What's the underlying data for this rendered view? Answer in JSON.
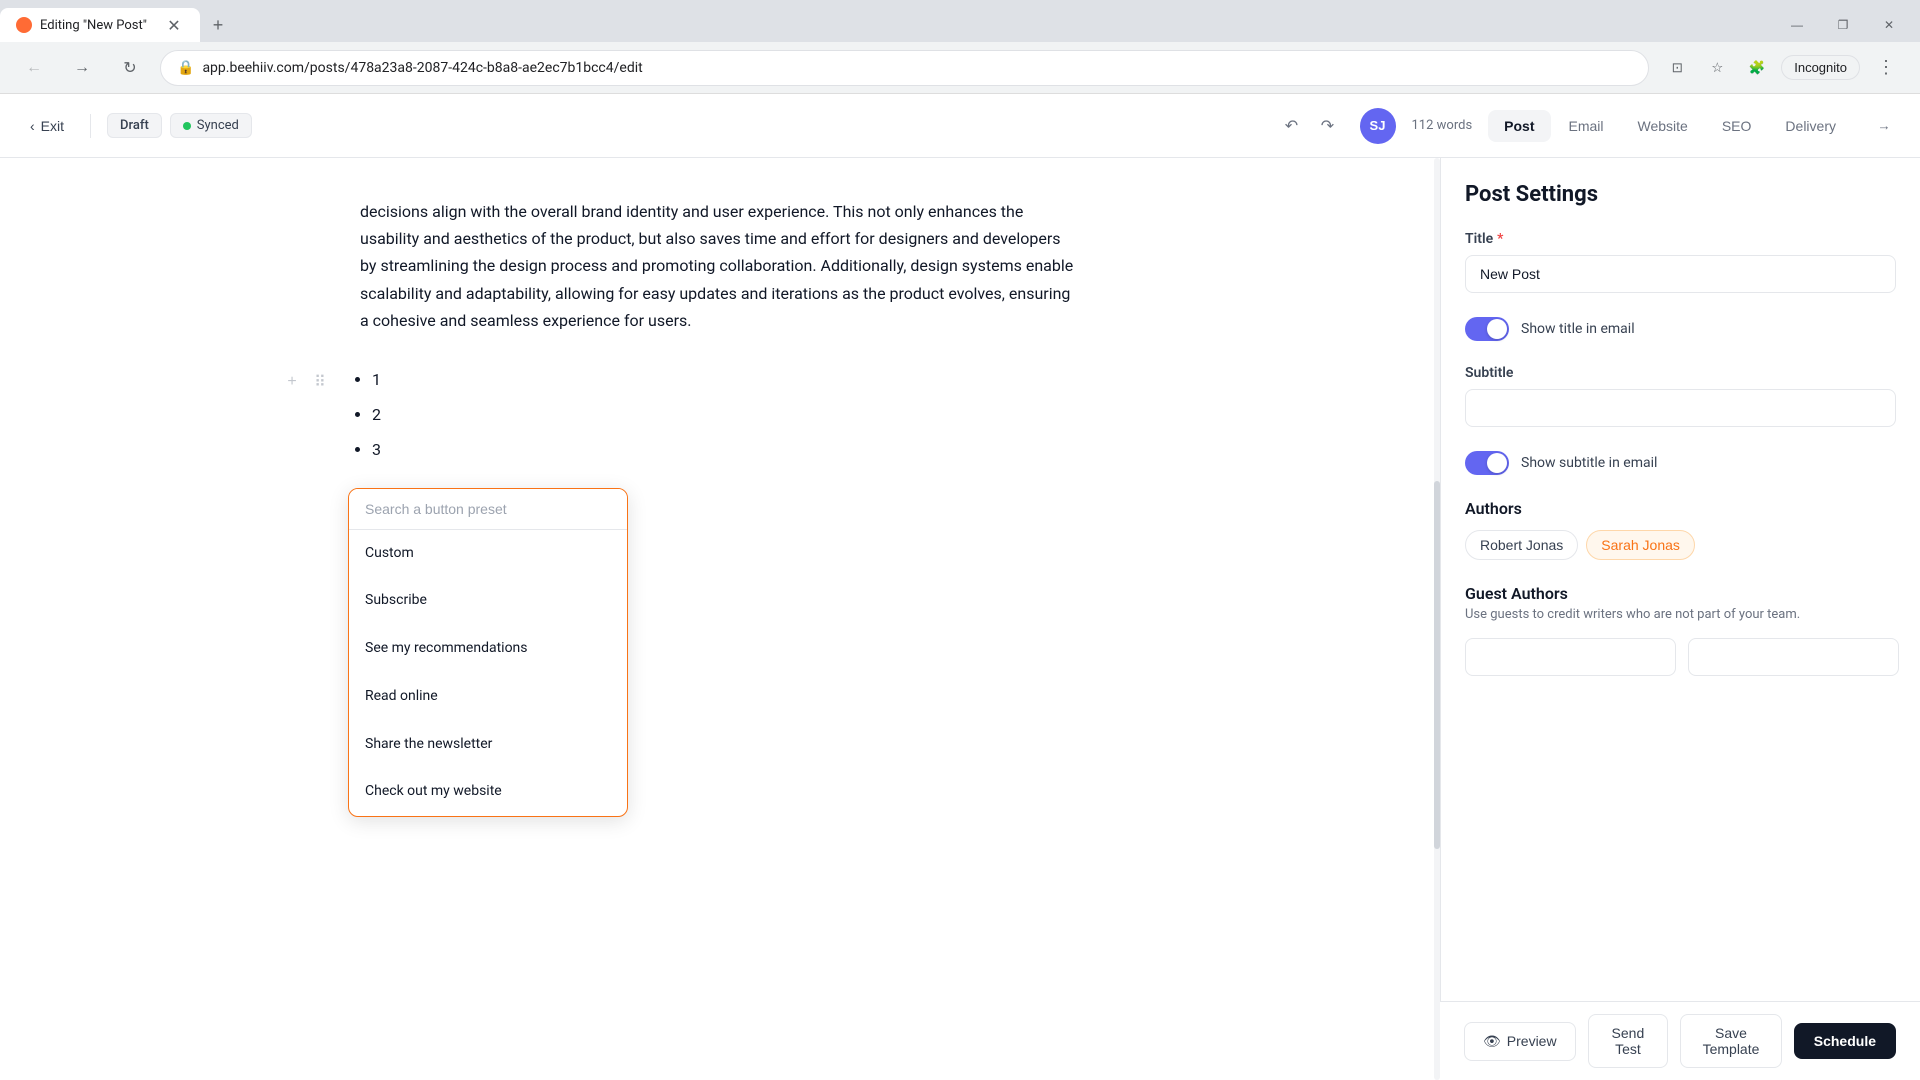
{
  "browser": {
    "tab_title": "Editing \"New Post\"",
    "url": "app.beehiiv.com/posts/478a23a8-2087-424c-b8a8-ae2ec7b1bcc4/edit",
    "new_tab_label": "+",
    "profile_label": "Incognito"
  },
  "toolbar": {
    "exit_label": "Exit",
    "draft_label": "Draft",
    "synced_label": "Synced",
    "avatar_label": "SJ",
    "word_count": "112 words",
    "tabs": [
      "Post",
      "Email",
      "Website",
      "SEO",
      "Delivery"
    ],
    "active_tab": "Post"
  },
  "editor": {
    "paragraph": "decisions align with the overall brand identity and user experience. This not only enhances the usability and aesthetics of the product, but also saves time and effort for designers and developers by streamlining the design process and promoting collaboration. Additionally, design systems enable scalability and adaptability, allowing for easy updates and iterations as the product evolves, ensuring a cohesive and seamless experience for users.",
    "list_items": [
      "1",
      "2",
      "3"
    ],
    "dropdown": {
      "placeholder": "Search a button preset",
      "items": [
        "Custom",
        "Subscribe",
        "See my recommendations",
        "Read online",
        "Share the newsletter",
        "Check out my website"
      ]
    }
  },
  "panel": {
    "title": "Post Settings",
    "title_label": "Title",
    "title_required": "*",
    "title_value": "New Post",
    "title_placeholder": "",
    "show_title_email_label": "Show title in email",
    "subtitle_label": "Subtitle",
    "subtitle_placeholder": "",
    "show_subtitle_email_label": "Show subtitle in email",
    "authors_label": "Authors",
    "authors": [
      {
        "name": "Robert Jonas",
        "active": false
      },
      {
        "name": "Sarah Jonas",
        "active": true
      }
    ],
    "guest_authors_label": "Guest Authors",
    "guest_authors_desc": "Use guests to credit writers who are not part of your team."
  },
  "actions": {
    "preview_label": "Preview",
    "send_test_label": "Send Test",
    "save_template_label": "Save Template",
    "schedule_label": "Schedule"
  }
}
